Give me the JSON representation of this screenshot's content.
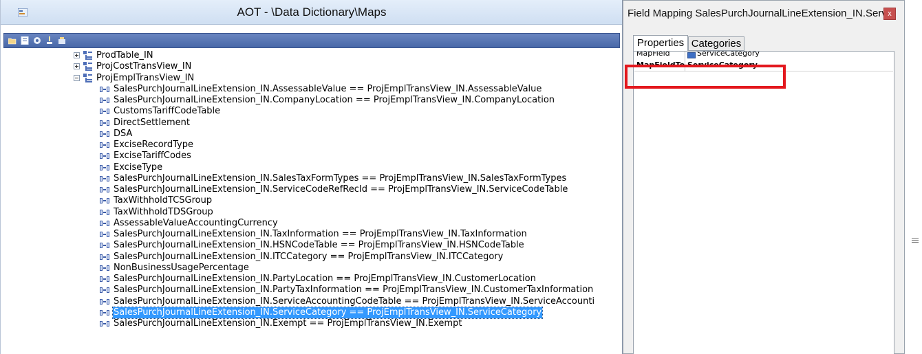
{
  "aot_window": {
    "title": "AOT - \\Data Dictionary\\Maps"
  },
  "tree": {
    "nodes": [
      {
        "label": "ProdTable_IN",
        "kind": "map",
        "expander": "plus"
      },
      {
        "label": "ProjCostTransView_IN",
        "kind": "map",
        "expander": "plus"
      },
      {
        "label": "ProjEmplTransView_IN",
        "kind": "map",
        "expander": "minus"
      },
      {
        "label": "SalesPurchJournalLineExtension_IN.AssessableValue == ProjEmplTransView_IN.AssessableValue",
        "kind": "field"
      },
      {
        "label": "SalesPurchJournalLineExtension_IN.CompanyLocation == ProjEmplTransView_IN.CompanyLocation",
        "kind": "field"
      },
      {
        "label": "CustomsTariffCodeTable",
        "kind": "field"
      },
      {
        "label": "DirectSettlement",
        "kind": "field"
      },
      {
        "label": "DSA",
        "kind": "field"
      },
      {
        "label": "ExciseRecordType",
        "kind": "field"
      },
      {
        "label": "ExciseTariffCodes",
        "kind": "field"
      },
      {
        "label": "ExciseType",
        "kind": "field"
      },
      {
        "label": "SalesPurchJournalLineExtension_IN.SalesTaxFormTypes == ProjEmplTransView_IN.SalesTaxFormTypes",
        "kind": "field"
      },
      {
        "label": "SalesPurchJournalLineExtension_IN.ServiceCodeRefRecId == ProjEmplTransView_IN.ServiceCodeTable",
        "kind": "field"
      },
      {
        "label": "TaxWithholdTCSGroup",
        "kind": "field"
      },
      {
        "label": "TaxWithholdTDSGroup",
        "kind": "field"
      },
      {
        "label": "AssessableValueAccountingCurrency",
        "kind": "field"
      },
      {
        "label": "SalesPurchJournalLineExtension_IN.TaxInformation == ProjEmplTransView_IN.TaxInformation",
        "kind": "field"
      },
      {
        "label": "SalesPurchJournalLineExtension_IN.HSNCodeTable == ProjEmplTransView_IN.HSNCodeTable",
        "kind": "field"
      },
      {
        "label": "SalesPurchJournalLineExtension_IN.ITCCategory == ProjEmplTransView_IN.ITCCategory",
        "kind": "field"
      },
      {
        "label": "NonBusinessUsagePercentage",
        "kind": "field"
      },
      {
        "label": "SalesPurchJournalLineExtension_IN.PartyLocation == ProjEmplTransView_IN.CustomerLocation",
        "kind": "field"
      },
      {
        "label": "SalesPurchJournalLineExtension_IN.PartyTaxInformation == ProjEmplTransView_IN.CustomerTaxInformation",
        "kind": "field"
      },
      {
        "label": "SalesPurchJournalLineExtension_IN.ServiceAccountingCodeTable == ProjEmplTransView_IN.ServiceAccounti",
        "kind": "field"
      },
      {
        "label": "SalesPurchJournalLineExtension_IN.ServiceCategory == ProjEmplTransView_IN.ServiceCategory",
        "kind": "field",
        "selected": true
      },
      {
        "label": "SalesPurchJournalLineExtension_IN.Exempt == ProjEmplTransView_IN.Exempt",
        "kind": "field"
      }
    ]
  },
  "property_window": {
    "title": "Field Mapping SalesPurchJournalLineExtension_IN.Serv...",
    "close_label": "x",
    "tabs": [
      "Properties",
      "Categories"
    ],
    "active_tab": "Properties",
    "rows": [
      {
        "name": "MapField",
        "value": "ServiceCategory"
      },
      {
        "name": "MapFieldTo",
        "value": "ServiceCategory"
      }
    ]
  },
  "colors": {
    "selection": "#3399ff",
    "highlight_box": "#e3181e",
    "toolbar": "#4868a8",
    "close_button": "#c7504f"
  }
}
